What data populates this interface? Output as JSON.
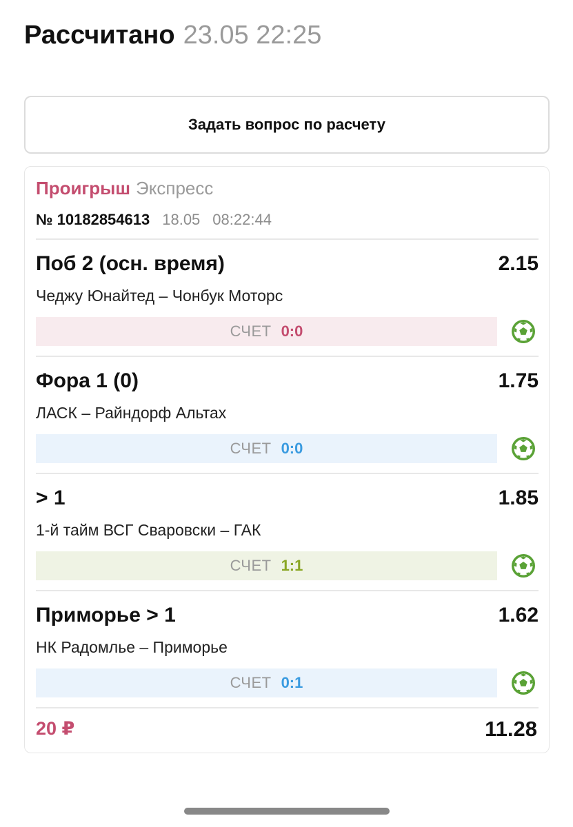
{
  "header": {
    "title": "Рассчитано",
    "date": "23.05 22:25"
  },
  "ask_button": {
    "label": "Задать вопрос по расчету"
  },
  "ticket": {
    "status": "Проигрыш",
    "type": "Экспресс",
    "number": "№ 10182854613",
    "date": "18.05",
    "time": "08:22:44",
    "bets": [
      {
        "market": "Поб 2 (осн. время)",
        "odds": "2.15",
        "event": "Чеджу Юнайтед – Чонбук Моторс",
        "score_label": "СЧЕТ",
        "score": "0:0",
        "score_color": "#c44d6f",
        "icon": "soccer-ball-icon"
      },
      {
        "market": "Фора 1 (0)",
        "odds": "1.75",
        "event": "ЛАСК – Райндорф Альтах",
        "score_label": "СЧЕТ",
        "score": "0:0",
        "score_color": "#3a9be0",
        "icon": "soccer-ball-icon"
      },
      {
        "market": "> 1",
        "odds": "1.85",
        "event": "1-й тайм ВСГ Сваровски – ГАК",
        "score_label": "СЧЕТ",
        "score": "1:1",
        "score_color": "#8aa624",
        "icon": "soccer-ball-icon"
      },
      {
        "market": "Приморье > 1",
        "odds": "1.62",
        "event": "НК Радомлье – Приморье",
        "score_label": "СЧЕТ",
        "score": "0:1",
        "score_color": "#3a9be0",
        "icon": "soccer-ball-icon"
      }
    ],
    "stake": "20 ₽",
    "total_odds": "11.28"
  },
  "colors": {
    "accent_red": "#c44d6f",
    "ball_green": "#5aa236"
  }
}
